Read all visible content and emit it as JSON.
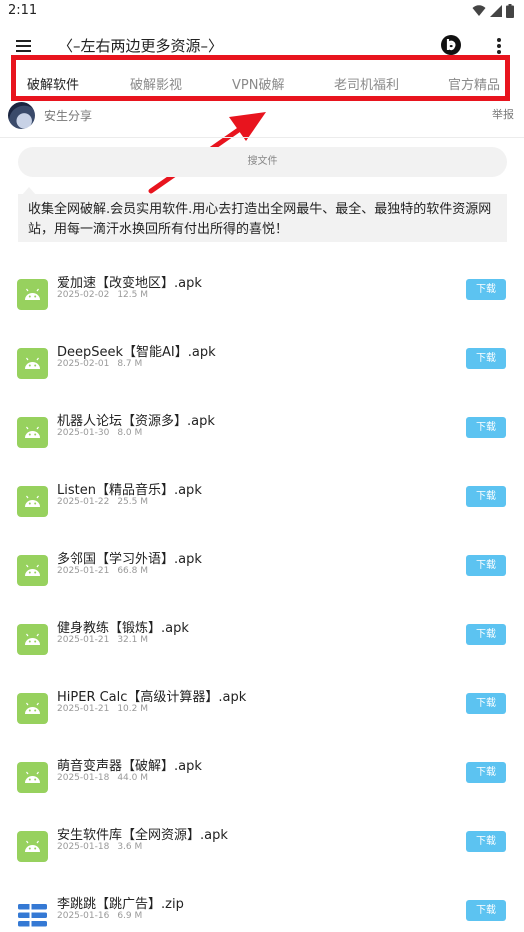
{
  "status_bar": {
    "time": "2:11"
  },
  "app_bar": {
    "title": "〈–左右两边更多资源–〉"
  },
  "tabs": [
    {
      "label": "破解软件",
      "active": true
    },
    {
      "label": "破解影视",
      "active": false
    },
    {
      "label": "VPN破解",
      "active": false
    },
    {
      "label": "老司机福利",
      "active": false
    },
    {
      "label": "官方精品",
      "active": false
    }
  ],
  "user": {
    "name": "安生分享",
    "report_label": "举报"
  },
  "search": {
    "placeholder": "搜文件"
  },
  "notice": {
    "text": "收集全网破解.会员实用软件.用心去打造出全网最牛、最全、最独特的软件资源网站，用每一滴汗水换回所有付出所得的喜悦！"
  },
  "files": [
    {
      "name": "爱加速【改变地区】.apk",
      "date": "2025-02-02",
      "size": "12.5 M",
      "icon": "android-icon",
      "action": "下载"
    },
    {
      "name": "DeepSeek【智能AI】.apk",
      "date": "2025-02-01",
      "size": "8.7 M",
      "icon": "android-icon",
      "action": "下载"
    },
    {
      "name": "机器人论坛【资源多】.apk",
      "date": "2025-01-30",
      "size": "8.0 M",
      "icon": "android-icon",
      "action": "下载"
    },
    {
      "name": "Listen【精品音乐】.apk",
      "date": "2025-01-22",
      "size": "25.5 M",
      "icon": "android-icon",
      "action": "下载"
    },
    {
      "name": "多邻国【学习外语】.apk",
      "date": "2025-01-21",
      "size": "66.8 M",
      "icon": "android-icon",
      "action": "下载"
    },
    {
      "name": "健身教练【锻炼】.apk",
      "date": "2025-01-21",
      "size": "32.1 M",
      "icon": "android-icon",
      "action": "下载"
    },
    {
      "name": "HiPER Calc【高级计算器】.apk",
      "date": "2025-01-21",
      "size": "10.2 M",
      "icon": "android-icon",
      "action": "下载"
    },
    {
      "name": "萌音变声器【破解】.apk",
      "date": "2025-01-18",
      "size": "44.0 M",
      "icon": "android-icon",
      "action": "下载"
    },
    {
      "name": "安生软件库【全网资源】.apk",
      "date": "2025-01-18",
      "size": "3.6 M",
      "icon": "android-icon",
      "action": "下载"
    },
    {
      "name": "李跳跳【跳广告】.zip",
      "date": "2025-01-16",
      "size": "6.9 M",
      "icon": "zip-archive-icon",
      "action": "下载"
    }
  ],
  "colors": {
    "highlight_box": "#e8141e",
    "download_button": "#5cc3f1",
    "apk_icon": "#97d15e",
    "zip_icon": "#3579d4"
  }
}
